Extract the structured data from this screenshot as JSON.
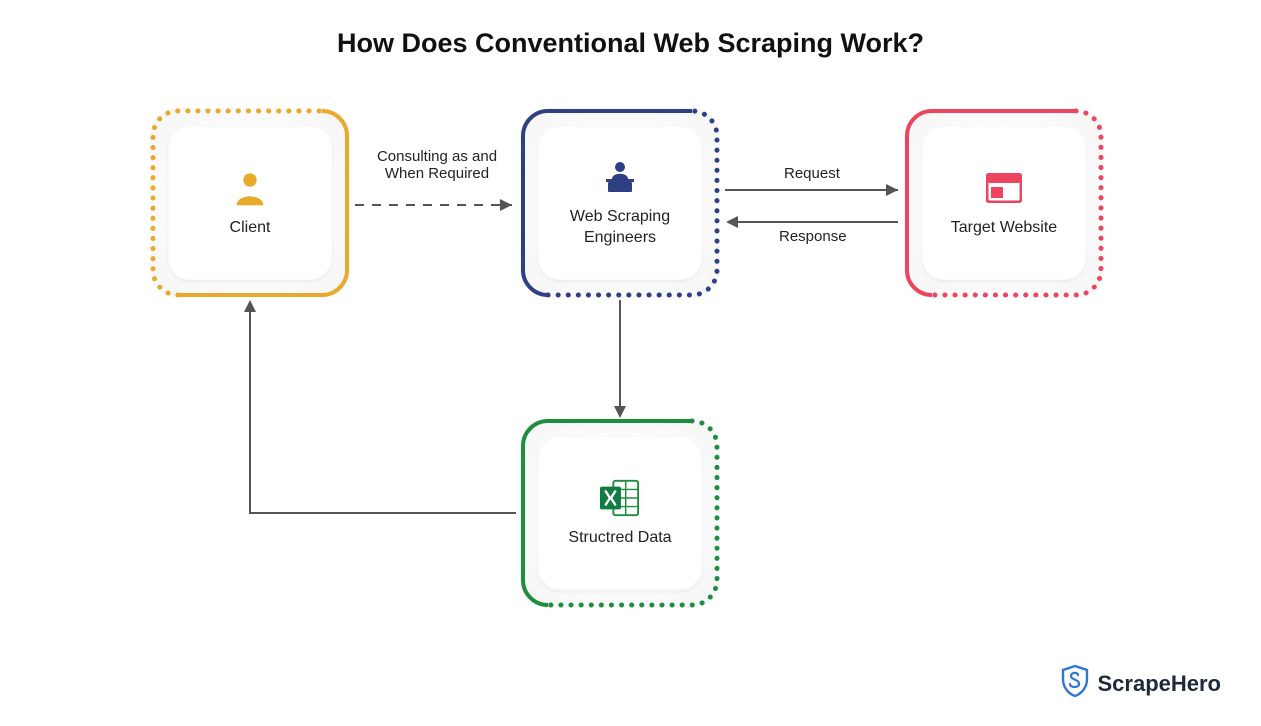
{
  "title": "How Does Conventional Web Scraping Work?",
  "nodes": {
    "client": {
      "label": "Client",
      "color": "#E9A92A"
    },
    "engineers": {
      "label": "Web Scraping\nEngineers",
      "color": "#2E3F84"
    },
    "website": {
      "label": "Target Website",
      "color": "#EC4560"
    },
    "data": {
      "label": "Structred Data",
      "color": "#1E8E3E"
    }
  },
  "edges": {
    "consulting": "Consulting as and\nWhen Required",
    "request": "Request",
    "response": "Response"
  },
  "icons": {
    "client": "person-icon",
    "engineers": "engineer-icon",
    "website": "browser-icon",
    "data": "excel-icon"
  },
  "brand": "ScrapeHero"
}
